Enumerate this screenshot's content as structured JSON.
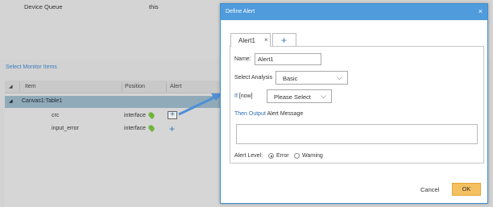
{
  "background": {
    "top": {
      "col1": "Device Queue",
      "col2": "this"
    },
    "section_title": "Select Monitor Items",
    "table": {
      "headers": [
        "Item",
        "Position",
        "Alert"
      ],
      "group": "Canvas1:Table1",
      "rows": [
        {
          "item": "crc",
          "position": "interface"
        },
        {
          "item": "input_error",
          "position": "interface"
        }
      ]
    }
  },
  "dialog": {
    "title": "Define Alert",
    "close_icon": "×",
    "tabs": [
      {
        "label": "Alert1",
        "close": "×"
      }
    ],
    "add_tab_icon": "+",
    "name_label": "Name:",
    "name_value": "Alert1",
    "analysis_label": "Select Analysis",
    "analysis_value": "Basic",
    "if_keyword": "If",
    "if_context": "[now]",
    "if_select": "Please Select",
    "then_output": "Then Output",
    "alert_message": "Alert Message",
    "alert_level_label": "Alert Level:",
    "level_options": [
      "Error",
      "Warning"
    ],
    "level_selected": "Error",
    "cancel": "Cancel",
    "ok": "OK"
  },
  "colors": {
    "header": "#4f9bdc",
    "link_blue": "#2f6eb3",
    "ok_button": "#f5c060",
    "group_row": "#90aab9"
  }
}
